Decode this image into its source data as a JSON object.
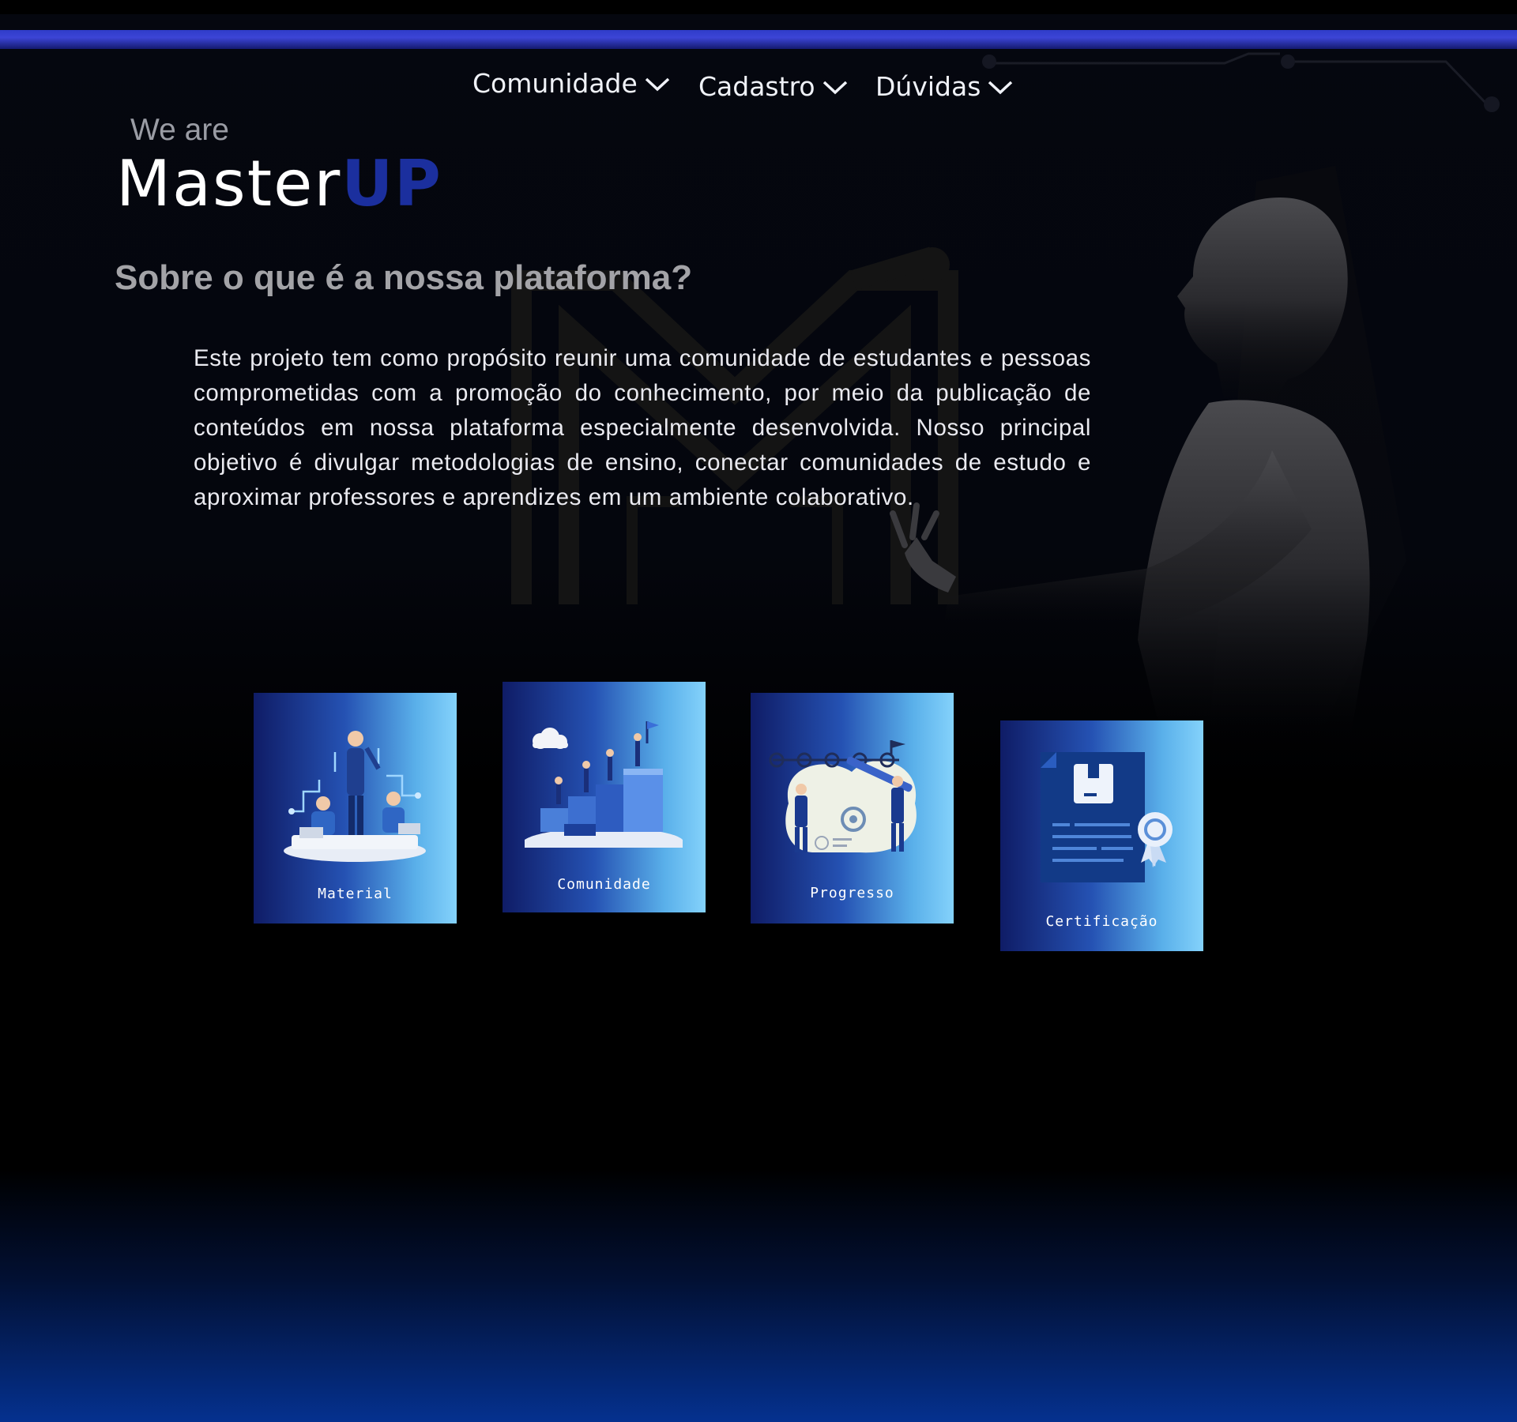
{
  "nav": {
    "items": [
      {
        "label": "Comunidade",
        "icon": "chevron-down-icon"
      },
      {
        "label": "Cadastro",
        "icon": "chevron-down-icon"
      },
      {
        "label": "Dúvidas",
        "icon": "chevron-down-icon"
      }
    ]
  },
  "hero": {
    "tagline": "We are",
    "brand_main": "Master",
    "brand_accent": "UP",
    "heading": "Sobre o que é a nossa plataforma?",
    "description": "Este projeto tem como propósito reunir uma comunidade de estudantes e pessoas comprometidas com a promoção do conhecimento, por meio da publicação de conteúdos em nossa plataforma especialmente desenvolvida. Nosso principal objetivo é divulgar metodologias de ensino, conectar comunidades de estudo e aproximar professores e aprendizes em um ambiente colaborativo."
  },
  "cards": [
    {
      "label": "Material",
      "icon": "team-study-illustration"
    },
    {
      "label": "Comunidade",
      "icon": "community-steps-illustration"
    },
    {
      "label": "Progresso",
      "icon": "progress-goal-illustration"
    },
    {
      "label": "Certificação",
      "icon": "certificate-document-illustration"
    }
  ],
  "colors": {
    "accent_bar": "#3c45d6",
    "brand_accent": "#1b2f9e",
    "heading": "#a3a3a7",
    "card_gradient_start": "#0f1c66",
    "card_gradient_end": "#84d2fb"
  }
}
